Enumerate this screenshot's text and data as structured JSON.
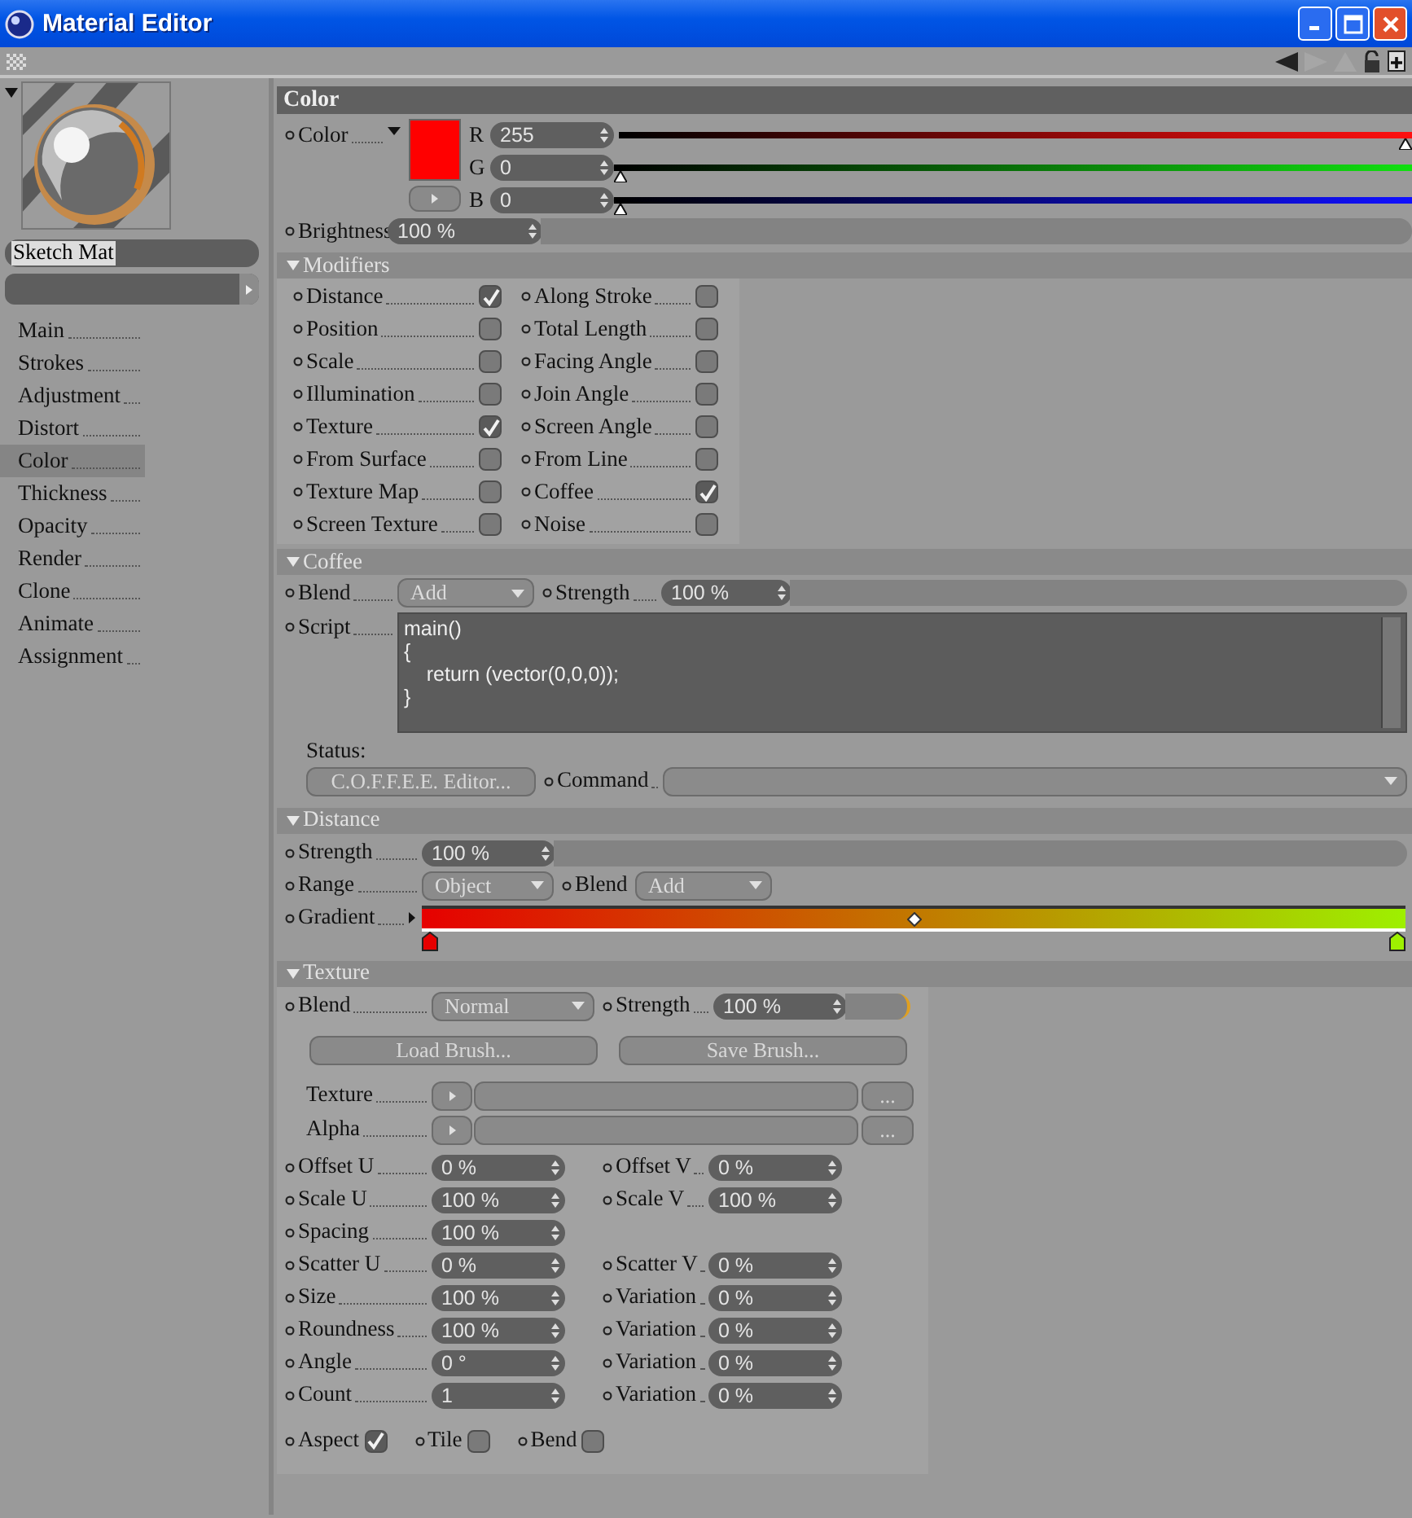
{
  "window": {
    "title": "Material Editor"
  },
  "sidebar": {
    "material_name": "Sketch Mat",
    "items": [
      {
        "label": "Main",
        "selected": false
      },
      {
        "label": "Strokes",
        "selected": false
      },
      {
        "label": "Adjustment",
        "selected": false
      },
      {
        "label": "Distort",
        "selected": false
      },
      {
        "label": "Color",
        "selected": true
      },
      {
        "label": "Thickness",
        "selected": false
      },
      {
        "label": "Opacity",
        "selected": false
      },
      {
        "label": "Render",
        "selected": false
      },
      {
        "label": "Clone",
        "selected": false
      },
      {
        "label": "Animate",
        "selected": false
      },
      {
        "label": "Assignment",
        "selected": false
      }
    ]
  },
  "color_section": {
    "title": "Color",
    "label": "Color",
    "channels": [
      {
        "name": "R",
        "value": "255",
        "level": 1
      },
      {
        "name": "G",
        "value": "0",
        "level": 0
      },
      {
        "name": "B",
        "value": "0",
        "level": 0
      }
    ],
    "brightness_label": "Brightness",
    "brightness": "100 %"
  },
  "modifiers": {
    "title": "Modifiers",
    "expanded": true,
    "items": [
      {
        "label": "Distance",
        "checked": true
      },
      {
        "label": "Along Stroke",
        "checked": false
      },
      {
        "label": "Position",
        "checked": false
      },
      {
        "label": "Total Length",
        "checked": false
      },
      {
        "label": "Scale",
        "checked": false
      },
      {
        "label": "Facing Angle",
        "checked": false
      },
      {
        "label": "Illumination",
        "checked": false
      },
      {
        "label": "Join Angle",
        "checked": false
      },
      {
        "label": "Texture",
        "checked": true
      },
      {
        "label": "Screen Angle",
        "checked": false
      },
      {
        "label": "From Surface",
        "checked": false
      },
      {
        "label": "From Line",
        "checked": false
      },
      {
        "label": "Texture Map",
        "checked": false
      },
      {
        "label": "Coffee",
        "checked": true
      },
      {
        "label": "Screen Texture",
        "checked": false
      },
      {
        "label": "Noise",
        "checked": false
      }
    ]
  },
  "coffee": {
    "title": "Coffee",
    "expanded": true,
    "blend_label": "Blend",
    "blend": "Add",
    "strength_label": "Strength",
    "strength": "100 %",
    "script_label": "Script",
    "script": "main()\n{\n    return (vector(0,0,0));\n}",
    "status_label": "Status:",
    "editor_button": "C.O.F.F.E.E. Editor...",
    "command_label": "Command"
  },
  "distance": {
    "title": "Distance",
    "expanded": true,
    "strength_label": "Strength",
    "strength": "100 %",
    "range_label": "Range",
    "range": "Object",
    "blend_label": "Blend",
    "blend": "Add",
    "gradient_label": "Gradient",
    "knots": [
      {
        "color": "#e60000"
      },
      {
        "color": "#9ef000"
      }
    ]
  },
  "texture": {
    "title": "Texture",
    "expanded": true,
    "blend_label": "Blend",
    "blend": "Normal",
    "strength_label": "Strength",
    "strength": "100 %",
    "buttons": [
      "Load Brush...",
      "Save Brush..."
    ],
    "files": [
      {
        "label": "Texture",
        "browse": "..."
      },
      {
        "label": "Alpha",
        "browse": "..."
      }
    ],
    "rows": [
      {
        "left": {
          "label": "Offset U",
          "value": "0 %"
        },
        "right": {
          "label": "Offset V",
          "value": "0 %"
        }
      },
      {
        "left": {
          "label": "Scale U",
          "value": "100 %"
        },
        "right": {
          "label": "Scale V",
          "value": "100 %"
        }
      },
      {
        "left": {
          "label": "Spacing",
          "value": "100 %"
        }
      },
      {
        "left": {
          "label": "Scatter U",
          "value": "0 %"
        },
        "right": {
          "label": "Scatter V",
          "value": "0 %"
        }
      },
      {
        "left": {
          "label": "Size",
          "value": "100 %"
        },
        "right": {
          "label": "Variation",
          "value": "0 %"
        }
      },
      {
        "left": {
          "label": "Roundness",
          "value": "100 %"
        },
        "right": {
          "label": "Variation",
          "value": "0 %"
        }
      },
      {
        "left": {
          "label": "Angle",
          "value": "0 °"
        },
        "right": {
          "label": "Variation",
          "value": "0 %"
        }
      },
      {
        "left": {
          "label": "Count",
          "value": "1"
        },
        "right": {
          "label": "Variation",
          "value": "0 %"
        }
      }
    ],
    "options": [
      {
        "label": "Aspect",
        "checked": true
      },
      {
        "label": "Tile",
        "checked": false
      },
      {
        "label": "Bend",
        "checked": false
      }
    ]
  }
}
